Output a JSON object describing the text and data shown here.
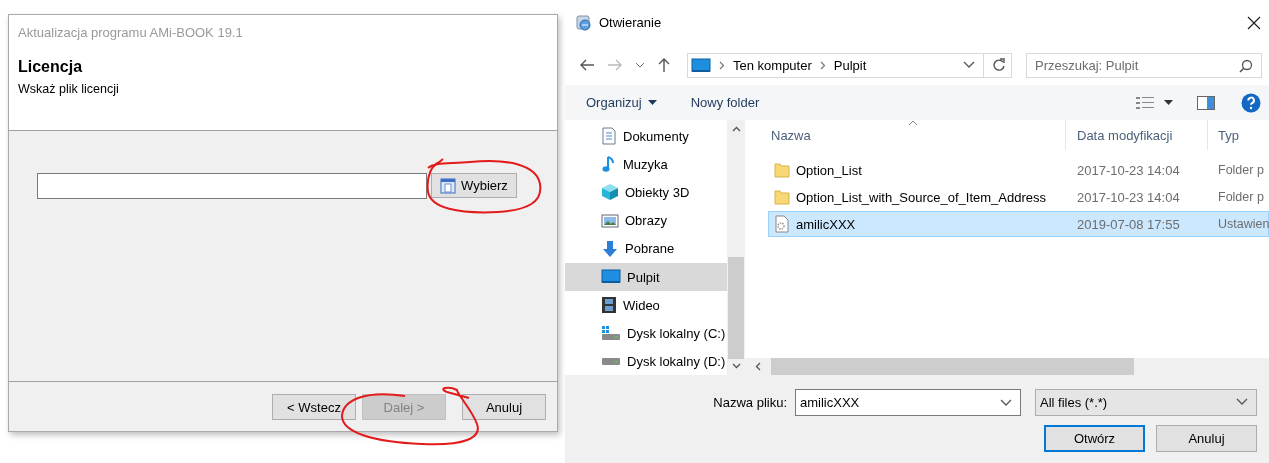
{
  "wizard": {
    "title": "Aktualizacja programu AMi-BOOK 19.1",
    "heading": "Licencja",
    "subtitle": "Wskaż plik licencji",
    "browse_button": "Wybierz",
    "buttons": [
      {
        "label": "< Wstecz",
        "disabled": false
      },
      {
        "label": "Dalej >",
        "disabled": true
      },
      {
        "label": "Anuluj",
        "disabled": false
      }
    ]
  },
  "dialog": {
    "title": "Otwieranie",
    "breadcrumb": [
      "Ten komputer",
      "Pulpit"
    ],
    "search": {
      "placeholder": "Przeszukaj: Pulpit"
    },
    "toolbar": [
      "Organizuj",
      "Nowy folder"
    ],
    "nav_items": [
      {
        "label": "Dokumenty",
        "kind": "documents",
        "selected": false
      },
      {
        "label": "Muzyka",
        "kind": "music",
        "selected": false
      },
      {
        "label": "Obiekty 3D",
        "kind": "cube",
        "selected": false
      },
      {
        "label": "Obrazy",
        "kind": "pictures",
        "selected": false
      },
      {
        "label": "Pobrane",
        "kind": "download",
        "selected": false
      },
      {
        "label": "Pulpit",
        "kind": "desktop",
        "selected": true
      },
      {
        "label": "Wideo",
        "kind": "video",
        "selected": false
      },
      {
        "label": "Dysk lokalny (C:)",
        "kind": "system-drive",
        "selected": false
      },
      {
        "label": "Dysk lokalny (D:)",
        "kind": "drive",
        "selected": false
      }
    ],
    "columns": [
      "Nazwa",
      "Data modyfikacji",
      "Typ"
    ],
    "files": [
      {
        "name": "Option_List",
        "modified": "2017-10-23 14:04",
        "type": "Folder p",
        "kind": "folder",
        "selected": false
      },
      {
        "name": "Option_List_with_Source_of_Item_Address",
        "modified": "2017-10-23 14:04",
        "type": "Folder p",
        "kind": "folder",
        "selected": false
      },
      {
        "name": "amilicXXX",
        "modified": "2019-07-08 17:55",
        "type": "Ustawien",
        "kind": "settings-file",
        "selected": true
      }
    ],
    "filename": {
      "label": "Nazwa pliku:",
      "value": "amilicXXX"
    },
    "filter": "All files (*.*)",
    "buttons": [
      "Otwórz",
      "Anuluj"
    ]
  }
}
